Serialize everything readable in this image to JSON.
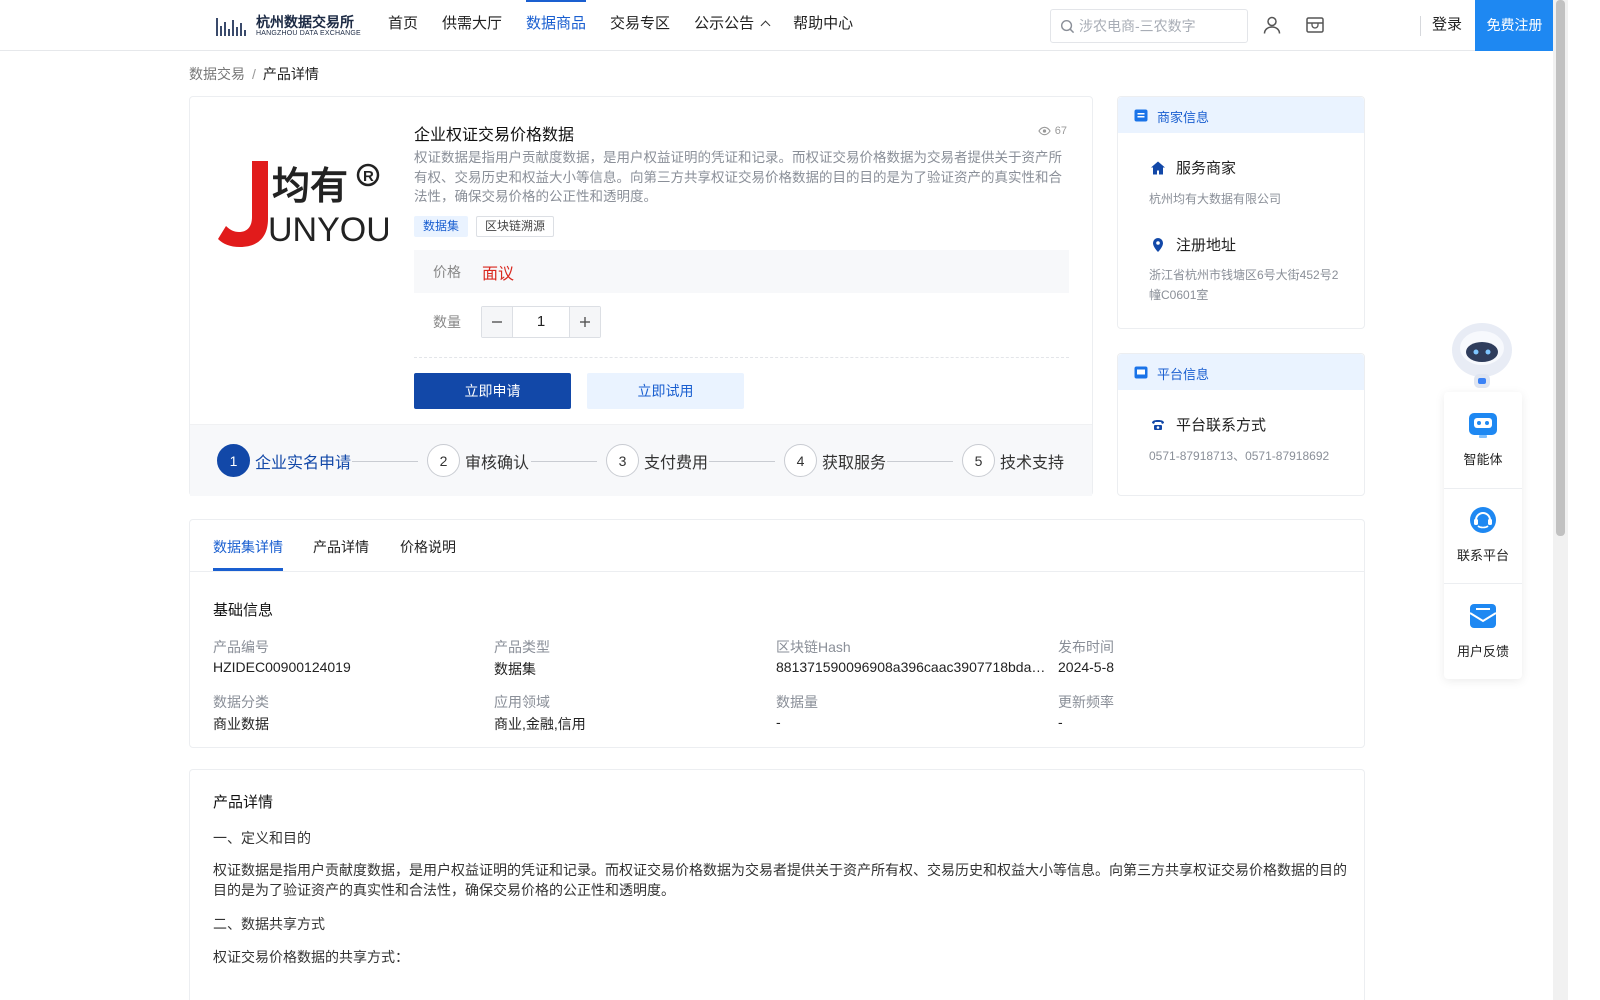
{
  "header": {
    "logo_cn": "杭州数据交易所",
    "logo_en": "HANGZHOU DATA EXCHANGE",
    "nav": [
      {
        "label": "首页"
      },
      {
        "label": "供需大厅"
      },
      {
        "label": "数据商品",
        "active": true
      },
      {
        "label": "交易专区"
      },
      {
        "label": "公示公告"
      },
      {
        "label": "帮助中心"
      }
    ],
    "search_placeholder": "涉农电商-三农数字",
    "login": "登录",
    "register": "免费注册",
    "accent": "#1a5fd0",
    "register_bg": "#1e88f2"
  },
  "breadcrumb": {
    "root": "数据交易",
    "sep": "/",
    "current": "产品详情"
  },
  "product": {
    "brand_logo_text": "均有",
    "brand_logo_letters": "UNYOU",
    "title": "企业权证交易价格数据",
    "views": "67",
    "description": "权证数据是指用户贡献度数据，是用户权益证明的凭证和记录。而权证交易价格数据为交易者提供关于资产所有权、交易历史和权益大小等信息。向第三方共享权证交易价格数据的目的目的是为了验证资产的真实性和合法性，确保交易价格的公正性和透明度。",
    "tags": [
      "数据集",
      "区块链溯源"
    ],
    "price_label": "价格",
    "price_value": "面议",
    "qty_label": "数量",
    "qty_value": "1",
    "apply_button": "立即申请",
    "trial_button": "立即试用",
    "price_color": "#d9281f"
  },
  "steps": [
    {
      "num": "1",
      "label": "企业实名申请",
      "active": true
    },
    {
      "num": "2",
      "label": "审核确认"
    },
    {
      "num": "3",
      "label": "支付费用"
    },
    {
      "num": "4",
      "label": "获取服务"
    },
    {
      "num": "5",
      "label": "技术支持"
    }
  ],
  "merchant": {
    "header": "商家信息",
    "service_label": "服务商家",
    "service_value": "杭州均有大数据有限公司",
    "address_label": "注册地址",
    "address_value": "浙江省杭州市钱塘区6号大街452号2幢C0601室"
  },
  "platform": {
    "header": "平台信息",
    "contact_label": "平台联系方式",
    "contact_value": "0571-87918713、0571-87918692"
  },
  "floating": {
    "items": [
      {
        "label": "智能体",
        "icon": "agent-icon"
      },
      {
        "label": "联系平台",
        "icon": "headset-icon"
      },
      {
        "label": "用户反馈",
        "icon": "feedback-icon"
      }
    ]
  },
  "details": {
    "tabs": [
      "数据集详情",
      "产品详情",
      "价格说明"
    ],
    "section_title": "基础信息",
    "fields": [
      {
        "label": "产品编号",
        "value": "HZIDEC00900124019"
      },
      {
        "label": "产品类型",
        "value": "数据集"
      },
      {
        "label": "区块链Hash",
        "value": "881371590096908a396caac3907718bda2…"
      },
      {
        "label": "发布时间",
        "value": "2024-5-8"
      },
      {
        "label": "数据分类",
        "value": "商业数据"
      },
      {
        "label": "应用领域",
        "value": "商业,金融,信用"
      },
      {
        "label": "数据量",
        "value": "-"
      },
      {
        "label": "更新频率",
        "value": "-"
      }
    ]
  },
  "product_detail": {
    "title": "产品详情",
    "h1": "一、定义和目的",
    "p1": "权证数据是指用户贡献度数据，是用户权益证明的凭证和记录。而权证交易价格数据为交易者提供关于资产所有权、交易历史和权益大小等信息。向第三方共享权证交易价格数据的目的目的是为了验证资产的真实性和合法性，确保交易价格的公正性和透明度。",
    "h2": "二、数据共享方式",
    "p2": "权证交易价格数据的共享方式："
  }
}
